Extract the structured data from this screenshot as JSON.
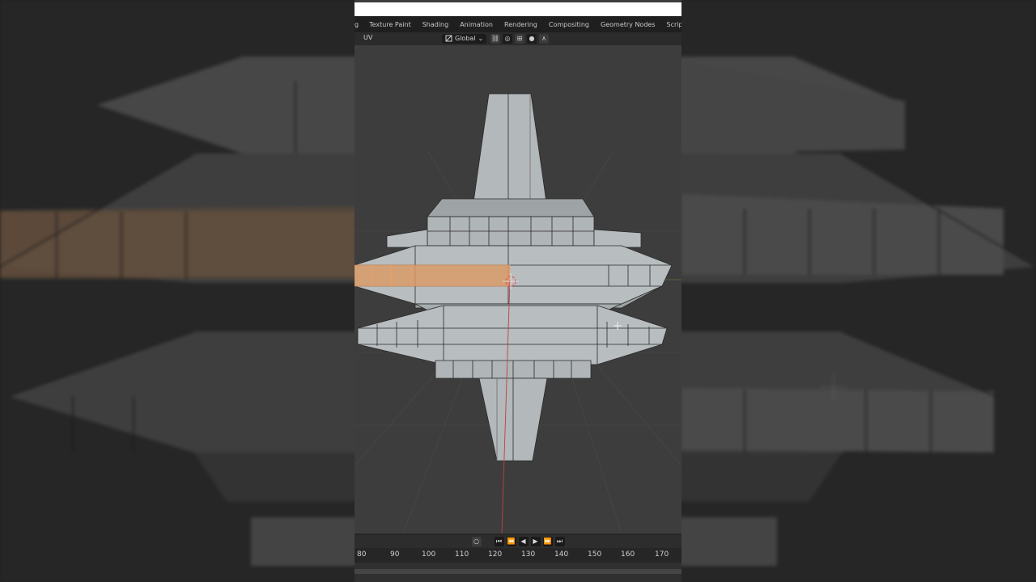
{
  "workspace_tabs": [
    {
      "label": "g",
      "partial": true
    },
    {
      "label": "Texture Paint"
    },
    {
      "label": "Shading"
    },
    {
      "label": "Animation"
    },
    {
      "label": "Rendering"
    },
    {
      "label": "Compositing"
    },
    {
      "label": "Geometry Nodes"
    },
    {
      "label": "Scripting"
    }
  ],
  "header": {
    "uv_label": "UV",
    "orientation": "Global",
    "icons": [
      "transform-orientation-icon",
      "link-icon",
      "proportional-edit-icon",
      "snap-icon",
      "pivot-icon",
      "falloff-icon"
    ]
  },
  "timeline": {
    "frame_numbers": [
      "80",
      "90",
      "100",
      "110",
      "120",
      "130",
      "140",
      "150",
      "160",
      "170"
    ],
    "controls": [
      "record-icon",
      "jump-start-icon",
      "prev-keyframe-icon",
      "play-reverse-icon",
      "play-icon",
      "next-keyframe-icon",
      "jump-end-icon"
    ]
  },
  "colors": {
    "selection": "#f0a060",
    "mesh_face": "#a8aeb0",
    "viewport_bg": "#3d3d3d",
    "x_axis": "#c04040",
    "y_axis": "#6a9a3a"
  }
}
